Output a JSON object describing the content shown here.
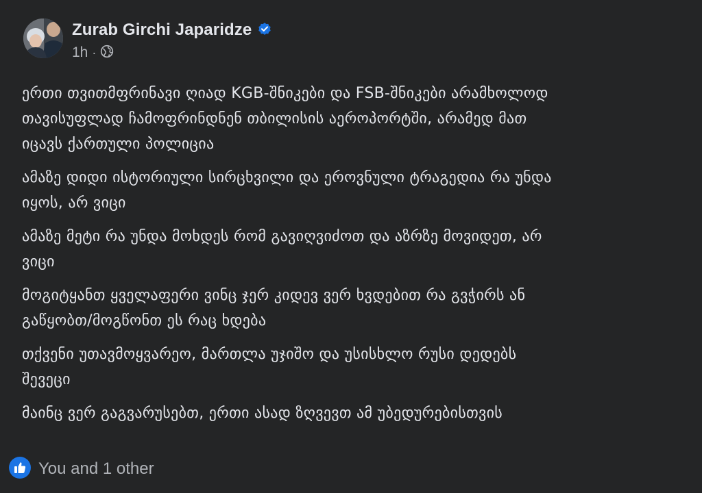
{
  "post": {
    "author": "Zurab Girchi Japaridze",
    "time": "1h",
    "separator": "·",
    "icons": {
      "verified": "verified-badge-icon",
      "audience": "globe-icon",
      "reaction": "like-icon"
    },
    "colors": {
      "background": "#242526",
      "text": "#e4e6eb",
      "secondary_text": "#b0b3b8",
      "accent": "#1b74e4"
    },
    "paragraphs": [
      "ერთი თვითმფრინავი ღიად KGB-შნიკები და FSB-შნიკები არამხოლოდ\nთავისუფლად ჩამოფრინდნენ თბილისის აეროპორტში, არამედ მათ\nიცავს ქართული პოლიცია",
      "ამაზე დიდი ისტორიული სირცხვილი და ეროვნული ტრაგედია რა უნდა\nიყოს, არ ვიცი",
      "ამაზე მეტი რა უნდა მოხდეს რომ გავიღვიძოთ და აზრზე მოვიდეთ, არ\nვიცი",
      "მოგიტყანთ ყველაფერი ვინც ჯერ კიდევ ვერ ხვდებით რა გვჭირს ან\nგაწყობთ/მოგწონთ ეს რაც ხდება",
      "თქვენი უთავმოყვარეო, მართლა უჯიშო და უსისხლო რუსი დედებს\nშევეცი",
      "მაინც ვერ გაგვარუსებთ, ერთი ასად ზღვევთ ამ უბედურებისთვის"
    ],
    "reactions_text": "You and 1 other"
  }
}
